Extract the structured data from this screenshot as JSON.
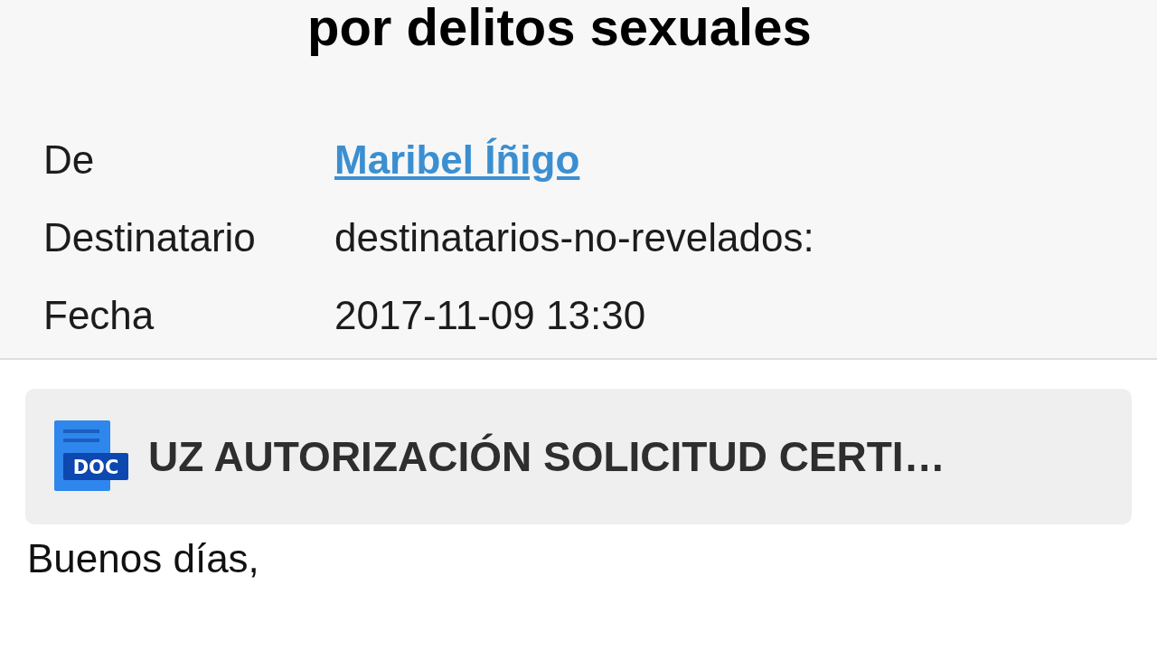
{
  "email": {
    "subject": "por delitos sexuales",
    "fields": [
      {
        "label": "De",
        "value": "Maribel Íñigo",
        "kind": "link"
      },
      {
        "label": "Destinatario",
        "value": "destinatarios-no-revelados:",
        "kind": "text"
      },
      {
        "label": "Fecha",
        "value": "2017-11-09 13:30",
        "kind": "text"
      }
    ],
    "attachment": {
      "icon_label": "DOC",
      "name": "UZ AUTORIZACIÓN SOLICITUD CERTI…"
    },
    "body": "Buenos días,"
  }
}
